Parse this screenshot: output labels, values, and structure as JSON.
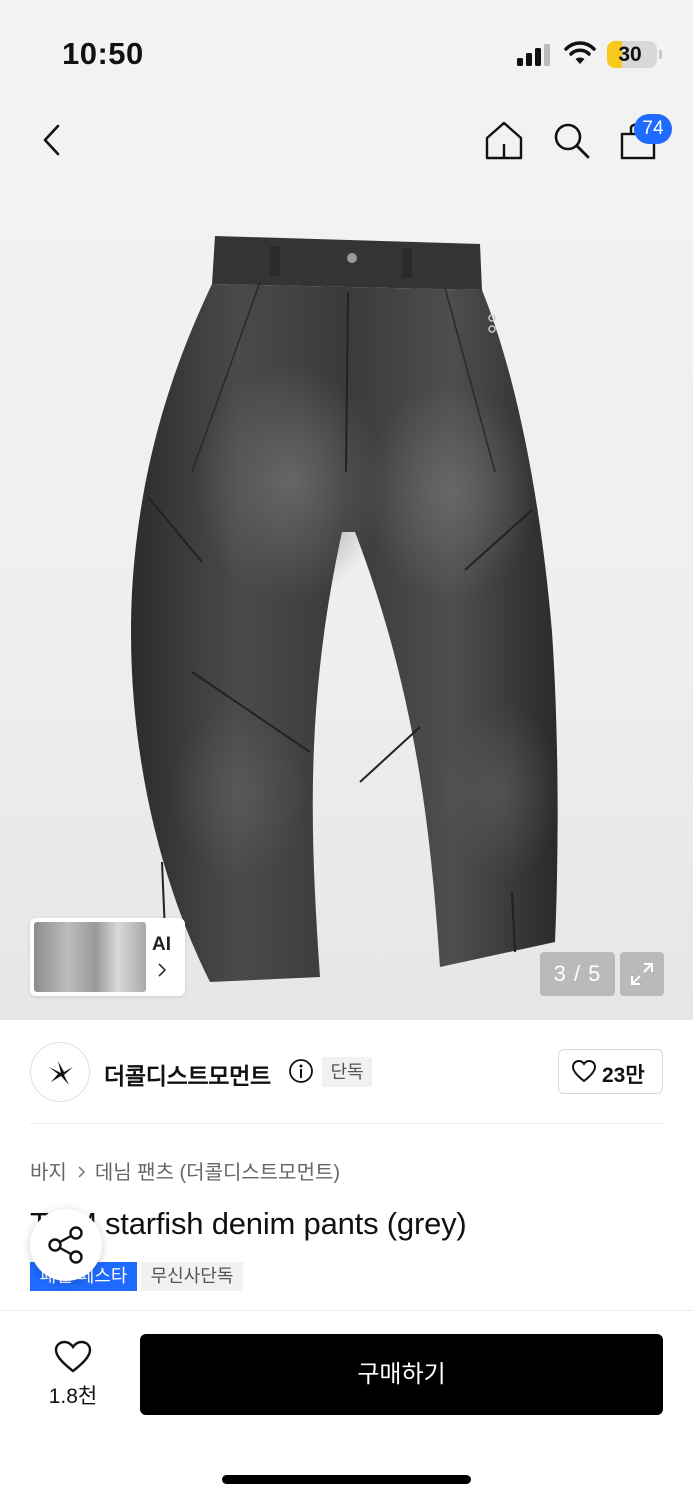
{
  "status_bar": {
    "time": "10:50",
    "battery_level": "30",
    "battery_color": "#f7c91c"
  },
  "nav": {
    "back_icon": "chevron-left-icon",
    "home_icon": "home-icon",
    "search_icon": "search-icon",
    "cart_icon": "shopping-bag-icon",
    "cart_count": "74",
    "badge_color": "#1f6bff"
  },
  "gallery": {
    "ai_label": "AI",
    "counter": "3 / 5",
    "expand_icon": "expand-icon"
  },
  "brand": {
    "name": "더콜디스트모먼트",
    "exclusive_label": "단독",
    "like_count": "23만"
  },
  "breadcrumb": {
    "category": "바지",
    "subcategory": "데님 팬츠 (더콜디스트모먼트)"
  },
  "product": {
    "title_prefix": "TC",
    "title_hidden": "M",
    "title_rest": " starfish denim pants (grey)",
    "tag_festival_prefix": "패션",
    "tag_festival_rest": " 페스타",
    "tag_exclusive": "무신사단독"
  },
  "bottom": {
    "wish_count": "1.8천",
    "buy_label": "구매하기",
    "accent_color": "#000000"
  }
}
